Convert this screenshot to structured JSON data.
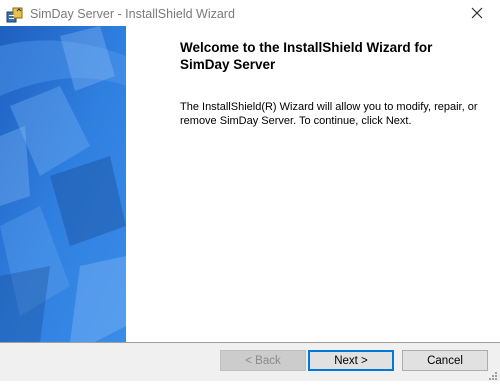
{
  "window": {
    "title": "SimDay Server - InstallShield Wizard",
    "app_icon": "installer-icon",
    "close_icon": "close-icon"
  },
  "content": {
    "heading": "Welcome to the InstallShield Wizard for SimDay Server",
    "body": "The InstallShield(R) Wizard will allow you to modify, repair, or remove SimDay Server. To continue, click Next."
  },
  "buttons": {
    "back_label": "< Back",
    "next_label": "Next >",
    "cancel_label": "Cancel"
  },
  "colors": {
    "sidebar_blue": "#2a78d8",
    "focus_border": "#0078d7"
  }
}
